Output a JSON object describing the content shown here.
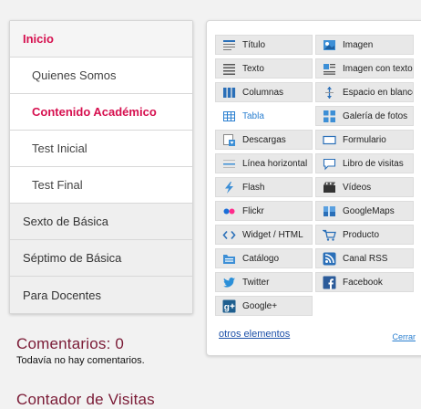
{
  "nav": {
    "items": [
      {
        "label": "Inicio"
      },
      {
        "label": "Quienes Somos"
      },
      {
        "label": "Contenido Académico"
      },
      {
        "label": "Test Inicial"
      },
      {
        "label": "Test Final"
      },
      {
        "label": "Sexto de Básica"
      },
      {
        "label": "Séptimo de Básica"
      },
      {
        "label": "Para Docentes"
      }
    ]
  },
  "comments": {
    "title": "Comentarios: 0",
    "empty": "Todavía no hay comentarios."
  },
  "counter": {
    "title": "Contador de Visitas"
  },
  "panel": {
    "tiles": [
      {
        "label": "Título",
        "icon": "title-icon"
      },
      {
        "label": "Imagen",
        "icon": "image-icon"
      },
      {
        "label": "Texto",
        "icon": "text-icon"
      },
      {
        "label": "Imagen con texto",
        "icon": "image-with-text-icon"
      },
      {
        "label": "Columnas",
        "icon": "columns-icon"
      },
      {
        "label": "Espacio en blanco",
        "icon": "blank-space-icon"
      },
      {
        "label": "Tabla",
        "icon": "table-icon"
      },
      {
        "label": "Galería de fotos",
        "icon": "photo-gallery-icon"
      },
      {
        "label": "Descargas",
        "icon": "downloads-icon"
      },
      {
        "label": "Formulario",
        "icon": "form-icon"
      },
      {
        "label": "Línea horizontal",
        "icon": "horizontal-line-icon"
      },
      {
        "label": "Libro de visitas",
        "icon": "guestbook-icon"
      },
      {
        "label": "Flash",
        "icon": "flash-icon"
      },
      {
        "label": "Vídeos",
        "icon": "videos-icon"
      },
      {
        "label": "Flickr",
        "icon": "flickr-icon"
      },
      {
        "label": "GoogleMaps",
        "icon": "googlemaps-icon"
      },
      {
        "label": "Widget / HTML",
        "icon": "widget-html-icon"
      },
      {
        "label": "Producto",
        "icon": "product-icon"
      },
      {
        "label": "Catálogo",
        "icon": "catalog-icon"
      },
      {
        "label": "Canal RSS",
        "icon": "rss-icon"
      },
      {
        "label": "Twitter",
        "icon": "twitter-icon"
      },
      {
        "label": "Facebook",
        "icon": "facebook-icon"
      },
      {
        "label": "Google+",
        "icon": "google-plus-icon"
      }
    ],
    "more_label": "otros elementos",
    "close_label": "Cerrar"
  },
  "colors": {
    "accent": "#d6104f",
    "link": "#1b4fa8",
    "heading": "#7a1a35"
  }
}
